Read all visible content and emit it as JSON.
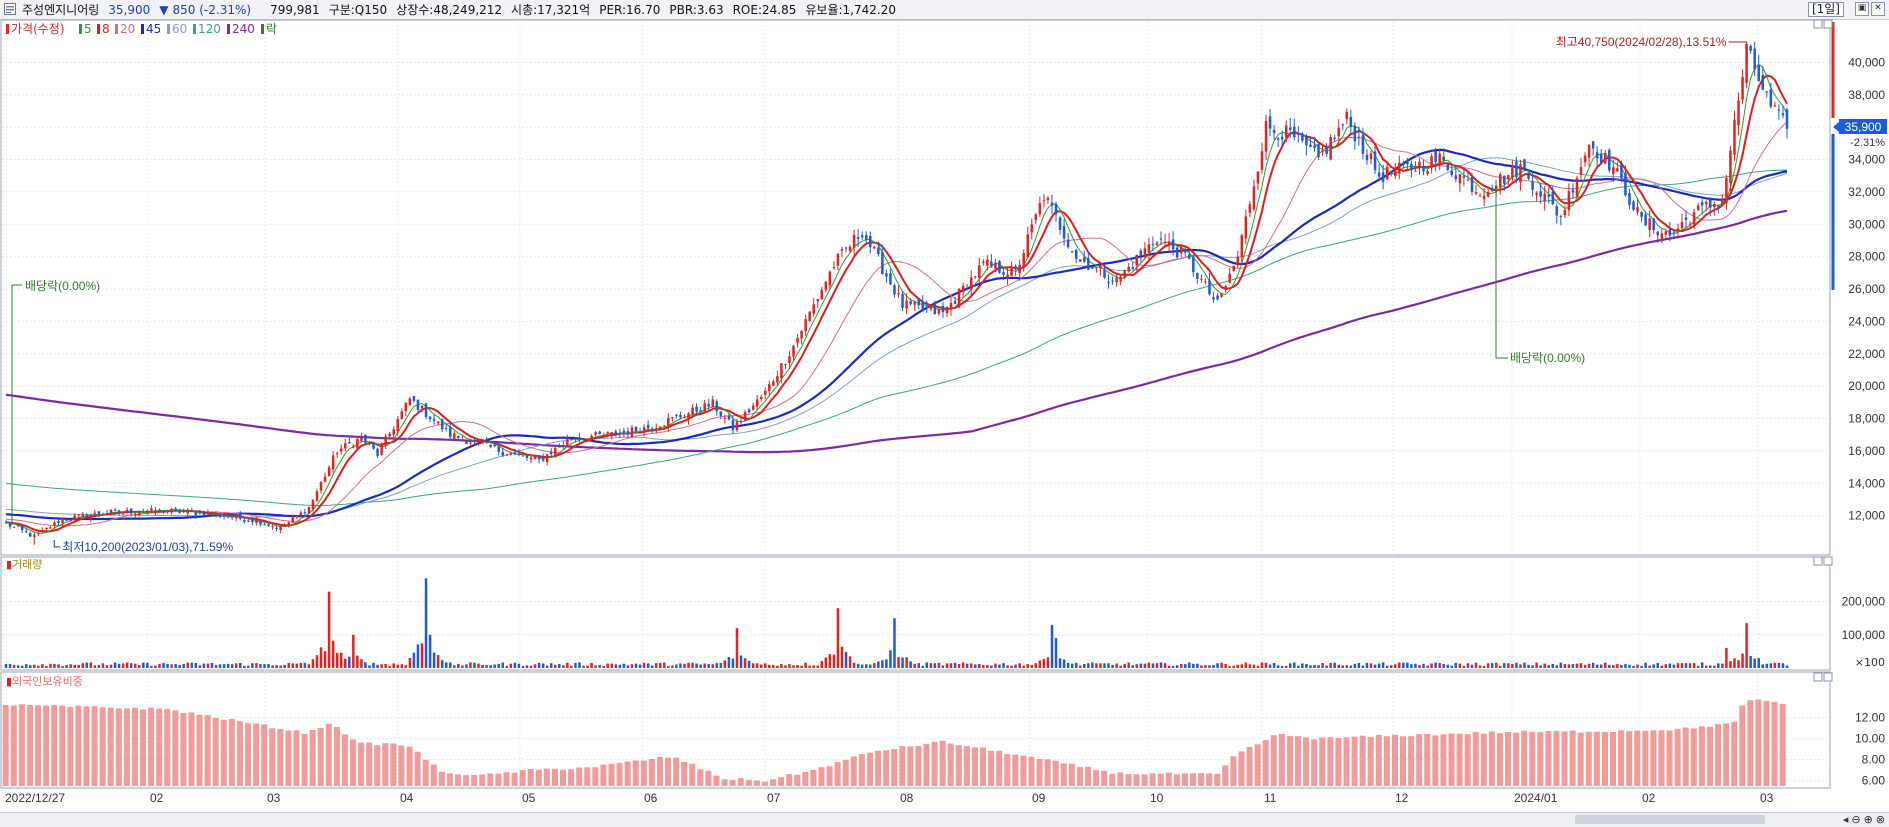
{
  "header": {
    "name": "주성엔지니어링",
    "price": "35,900",
    "arrow": "▼",
    "change": "850 (-2.31%)",
    "volume": "799,981",
    "stats": [
      "구분:Q150",
      "상장수:48,249,212",
      "시총:17,321억",
      "PER:16.70",
      "PBR:3.63",
      "ROE:24.85",
      "유보율:1,742.20"
    ],
    "period": "[1일]"
  },
  "legend": {
    "price": "가격(수정)",
    "ma": [
      "5",
      "8",
      "20",
      "45",
      "60",
      "120",
      "240"
    ],
    "ex": "락"
  },
  "colors": {
    "up": "#e32222",
    "down": "#1e5bd8",
    "ma5": "#2e9c2e",
    "ma8": "#e01c1c",
    "ma20": "#d96a8a",
    "ma45": "#1a2bbf",
    "ma60": "#7f9fd6",
    "ma120": "#3aa686",
    "ma240": "#7b2aa8",
    "foreign": "#f29b9b"
  },
  "annotations": {
    "high": "최고40,750(2024/02/28),13.51%",
    "low": "최저10,200(2023/01/03),71.59%",
    "dividend1": "배당락(0.00%)",
    "dividend2": "배당락(0.00%)"
  },
  "price_badge": {
    "value": "35,900",
    "pct": "-2.31%"
  },
  "panels": {
    "volume_title": "거래량",
    "volume_unit": "×100",
    "foreign_title": "외국인보유비중"
  },
  "x_axis": {
    "labels": [
      "2022/12/27",
      "02",
      "03",
      "04",
      "05",
      "06",
      "07",
      "08",
      "09",
      "10",
      "11",
      "12",
      "2024/01",
      "02",
      "03"
    ]
  },
  "chart_data": [
    {
      "type": "candlestick",
      "title": "가격(수정)",
      "y_ticks": [
        12000,
        14000,
        16000,
        18000,
        20000,
        22000,
        24000,
        26000,
        28000,
        30000,
        32000,
        34000,
        36000,
        38000,
        40000
      ],
      "ylim": [
        10000,
        42000
      ],
      "grid": true,
      "anchors": [
        [
          0,
          11500
        ],
        [
          7,
          10700
        ],
        [
          14,
          11800
        ],
        [
          25,
          12200
        ],
        [
          40,
          12300
        ],
        [
          50,
          12100
        ],
        [
          62,
          11700
        ],
        [
          68,
          11200
        ],
        [
          75,
          12500
        ],
        [
          82,
          16000
        ],
        [
          88,
          16800
        ],
        [
          92,
          15800
        ],
        [
          100,
          19200
        ],
        [
          110,
          17000
        ],
        [
          125,
          15800
        ],
        [
          132,
          15400
        ],
        [
          140,
          16800
        ],
        [
          150,
          17000
        ],
        [
          160,
          17500
        ],
        [
          175,
          18900
        ],
        [
          180,
          17400
        ],
        [
          188,
          19600
        ],
        [
          195,
          22500
        ],
        [
          205,
          27500
        ],
        [
          212,
          29600
        ],
        [
          222,
          25000
        ],
        [
          232,
          24500
        ],
        [
          242,
          27500
        ],
        [
          250,
          27000
        ],
        [
          257,
          31800
        ],
        [
          265,
          28000
        ],
        [
          275,
          26500
        ],
        [
          285,
          29200
        ],
        [
          292,
          28000
        ],
        [
          300,
          25000
        ],
        [
          305,
          28000
        ],
        [
          312,
          36000
        ],
        [
          318,
          35500
        ],
        [
          325,
          34000
        ],
        [
          332,
          36500
        ],
        [
          340,
          33000
        ],
        [
          348,
          33500
        ],
        [
          355,
          34000
        ],
        [
          365,
          32000
        ],
        [
          375,
          33500
        ],
        [
          385,
          30500
        ],
        [
          392,
          35000
        ],
        [
          398,
          33500
        ],
        [
          405,
          30200
        ],
        [
          412,
          29300
        ],
        [
          418,
          30700
        ],
        [
          425,
          31500
        ],
        [
          431,
          40750
        ],
        [
          437,
          37200
        ],
        [
          441,
          35900
        ]
      ],
      "volume_spikes": [
        [
          80,
          2300
        ],
        [
          86,
          1000
        ],
        [
          104,
          2700
        ],
        [
          105,
          1000
        ],
        [
          181,
          1200
        ],
        [
          206,
          1800
        ],
        [
          220,
          1500
        ],
        [
          259,
          1300
        ],
        [
          260,
          900
        ],
        [
          426,
          600
        ],
        [
          431,
          1350
        ]
      ],
      "volume_ylim": [
        0,
        2800
      ],
      "volume_ticks": [
        1000,
        2000
      ],
      "foreign_anchors": [
        [
          0,
          13.2
        ],
        [
          40,
          12.8
        ],
        [
          60,
          11.5
        ],
        [
          75,
          10.5
        ],
        [
          80,
          11.5
        ],
        [
          88,
          9.5
        ],
        [
          95,
          9.5
        ],
        [
          100,
          9.3
        ],
        [
          108,
          6.8
        ],
        [
          118,
          6.5
        ],
        [
          130,
          7.0
        ],
        [
          145,
          7.3
        ],
        [
          165,
          8.3
        ],
        [
          178,
          6.2
        ],
        [
          188,
          6.0
        ],
        [
          200,
          7.0
        ],
        [
          215,
          8.8
        ],
        [
          232,
          9.7
        ],
        [
          250,
          8.5
        ],
        [
          275,
          6.7
        ],
        [
          300,
          6.6
        ],
        [
          305,
          8.6
        ],
        [
          315,
          10.4
        ],
        [
          325,
          10.0
        ],
        [
          345,
          10.3
        ],
        [
          370,
          10.6
        ],
        [
          395,
          10.7
        ],
        [
          415,
          10.9
        ],
        [
          428,
          11.5
        ],
        [
          431,
          13.8
        ],
        [
          441,
          13.2
        ]
      ],
      "foreign_ylim": [
        5.5,
        14.8
      ],
      "foreign_ticks": [
        6.0,
        8.0,
        10.0,
        12.0
      ]
    }
  ]
}
